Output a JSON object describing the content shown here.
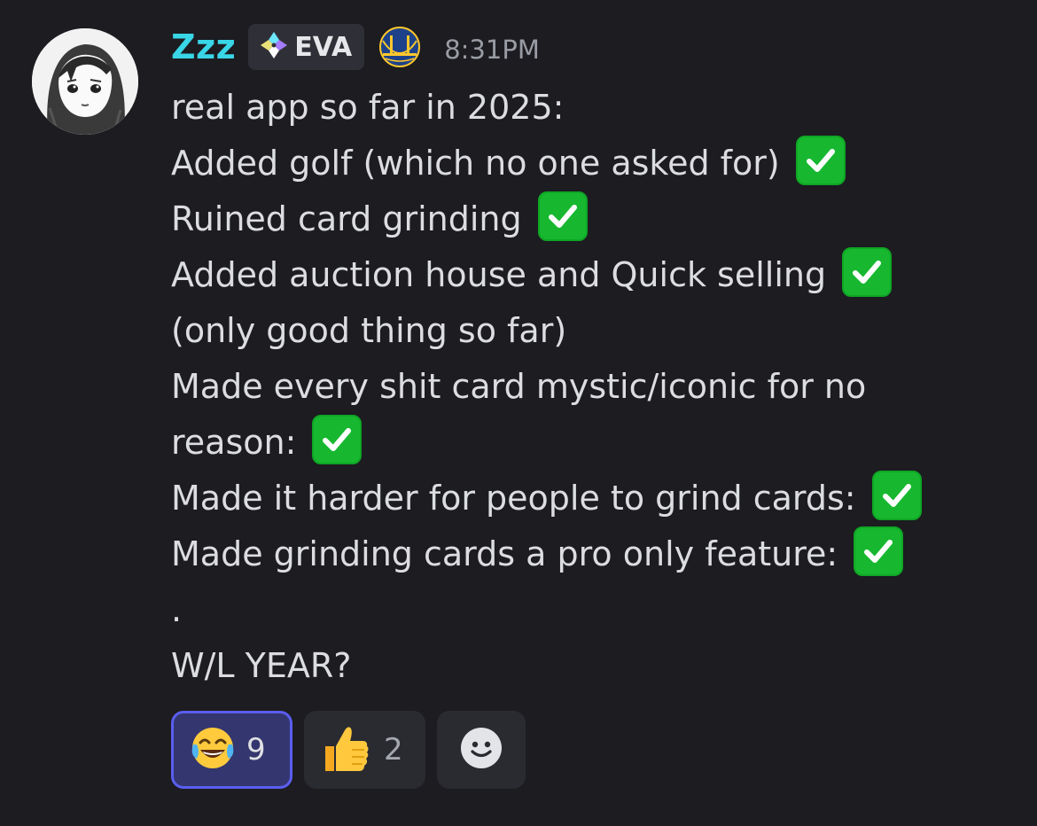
{
  "message": {
    "author": {
      "username": "Zzz",
      "tag_label": "EVA",
      "avatar_icon": "anime-girl-avatar",
      "tag_icon": "diamond-sparkle-icon",
      "role_icon": "golden-gate-bridge-badge-icon",
      "username_color": "#38d6e6"
    },
    "timestamp": "8:31PM",
    "lines": [
      "real app so far in 2025:",
      "Added golf (which no one asked for)",
      "Ruined card grinding",
      "Added auction house and Quick selling",
      "(only good thing so far)",
      "Made every shit card mystic/iconic for no",
      "reason:",
      "Made it harder for people to grind cards:",
      "Made grinding cards a pro only feature:",
      ".",
      "W/L YEAR?"
    ],
    "check_emoji": "white-check-mark-emoji"
  },
  "reactions": [
    {
      "emoji": "joy-emoji",
      "count": "9",
      "active": true
    },
    {
      "emoji": "thumbs-up-emoji",
      "count": "2",
      "active": false
    },
    {
      "emoji": "add-reaction-icon",
      "count": "",
      "active": false
    }
  ],
  "colors": {
    "background": "#1c1c21",
    "check_green": "#17b830",
    "active_reaction_border": "#5a5ef0"
  }
}
